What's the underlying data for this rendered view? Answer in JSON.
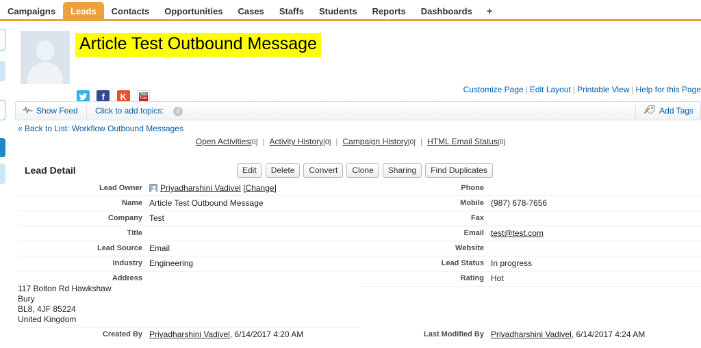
{
  "tabs": [
    {
      "label": "Campaigns",
      "active": false
    },
    {
      "label": "Leads",
      "active": true
    },
    {
      "label": "Contacts",
      "active": false
    },
    {
      "label": "Opportunities",
      "active": false
    },
    {
      "label": "Cases",
      "active": false
    },
    {
      "label": "Staffs",
      "active": false
    },
    {
      "label": "Students",
      "active": false
    },
    {
      "label": "Reports",
      "active": false
    },
    {
      "label": "Dashboards",
      "active": false
    },
    {
      "label": "+",
      "active": false
    }
  ],
  "header": {
    "record_title": "Article Test Outbound Message",
    "highlight_color": "#ffff00",
    "socials": [
      {
        "name": "twitter",
        "glyph": "",
        "color": "#32b3e8"
      },
      {
        "name": "facebook",
        "glyph": "f",
        "color": "#2d4d8e"
      },
      {
        "name": "klout",
        "glyph": "K",
        "color": "#e8502a"
      },
      {
        "name": "youtube",
        "glyph": "You Tube",
        "color": "#cc1f1f"
      }
    ]
  },
  "page_links": [
    {
      "label": "Customize Page"
    },
    {
      "label": "Edit Layout"
    },
    {
      "label": "Printable View"
    },
    {
      "label": "Help for this Page"
    }
  ],
  "feedbar": {
    "show_feed_label": "Show Feed",
    "topics_label": "Click to add topics:",
    "info_glyph": "i",
    "add_tags_label": "Add Tags"
  },
  "back_link": "« Back to List: Workflow Outbound Messages",
  "related_links": [
    {
      "label": "Open Activities",
      "count": "[0]"
    },
    {
      "label": "Activity History",
      "count": "[0]"
    },
    {
      "label": "Campaign History",
      "count": "[0]"
    },
    {
      "label": "HTML Email Status",
      "count": "[0]"
    }
  ],
  "detail": {
    "section_title": "Lead Detail",
    "buttons": [
      {
        "label": "Edit"
      },
      {
        "label": "Delete"
      },
      {
        "label": "Convert"
      },
      {
        "label": "Clone"
      },
      {
        "label": "Sharing"
      },
      {
        "label": "Find Duplicates"
      }
    ],
    "left": [
      {
        "label": "Lead Owner",
        "value": "Priyadharshini Vadivel",
        "extra": "[Change]",
        "icon": true,
        "link": true
      },
      {
        "label": "Name",
        "value": "Article Test Outbound Message"
      },
      {
        "label": "Company",
        "value": "Test"
      },
      {
        "label": "Title",
        "value": ""
      },
      {
        "label": "Lead Source",
        "value": "Email"
      },
      {
        "label": "Industry",
        "value": "Engineering"
      }
    ],
    "right": [
      {
        "label": "Phone",
        "value": ""
      },
      {
        "label": "Mobile",
        "value": "(987) 678-7656"
      },
      {
        "label": "Fax",
        "value": ""
      },
      {
        "label": "Email",
        "value": "test@test.com",
        "link": true
      },
      {
        "label": "Website",
        "value": ""
      },
      {
        "label": "Lead Status",
        "value": "In progress"
      },
      {
        "label": "Rating",
        "value": "Hot"
      }
    ],
    "address": {
      "label": "Address",
      "lines": [
        "117 Bolton Rd Hawkshaw",
        "Bury",
        "BL8, 4JF 85224",
        "United Kingdom"
      ]
    },
    "created_by": {
      "label": "Created By",
      "user": "Priyadharshini Vadivel",
      "timestamp": ", 6/14/2017 4:20 AM"
    },
    "last_modified_by": {
      "label": "Last Modified By",
      "user": "Priyadharshini Vadivel",
      "timestamp": ", 6/14/2017 4:24 AM"
    }
  }
}
